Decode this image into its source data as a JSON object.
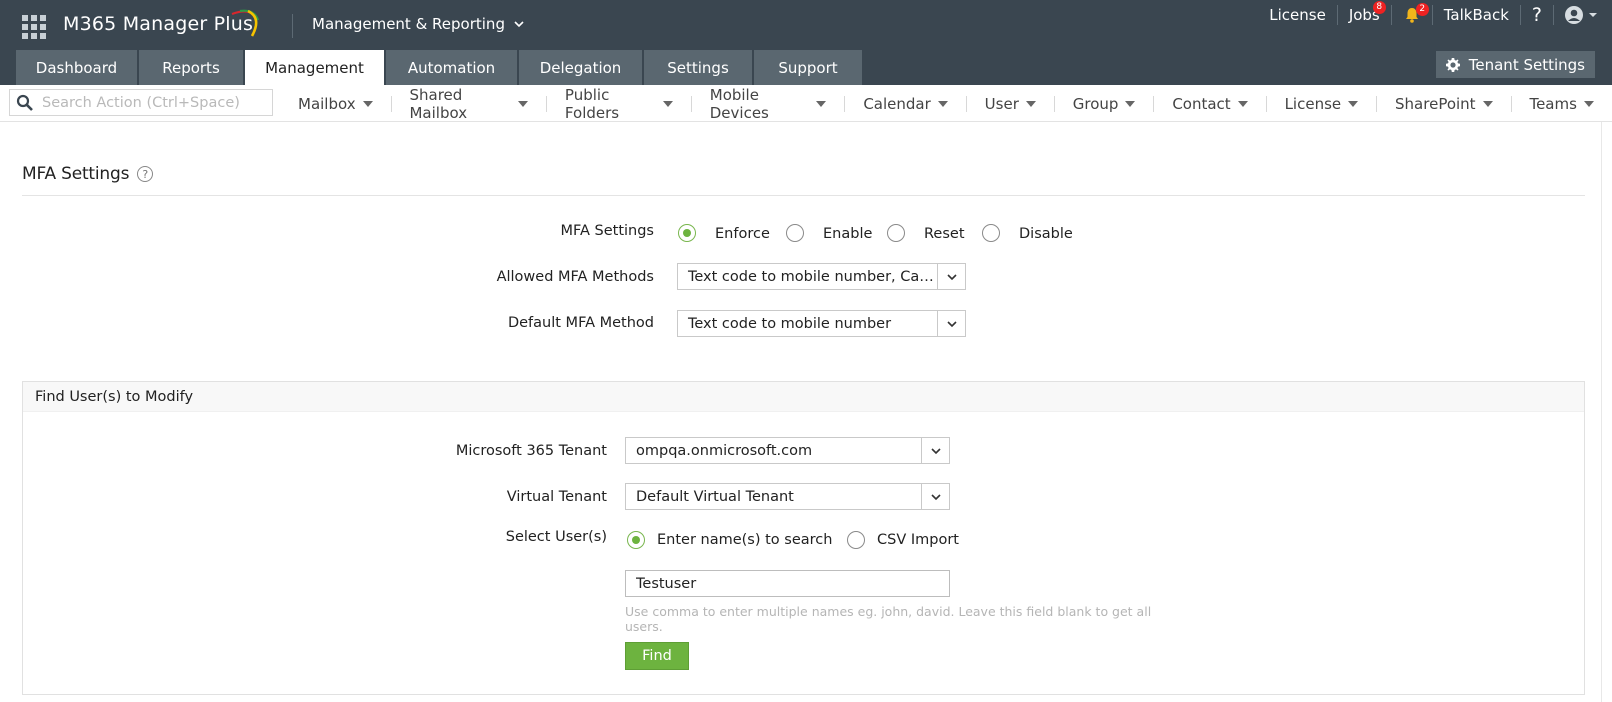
{
  "header": {
    "app_name": "M365 Manager Plus",
    "module": "Management & Reporting",
    "right": {
      "license": "License",
      "jobs": "Jobs",
      "jobs_badge": "8",
      "alerts_badge": "2",
      "talkback": "TalkBack",
      "help": "?"
    },
    "tabs": [
      {
        "label": "Dashboard",
        "active": false
      },
      {
        "label": "Reports",
        "active": false
      },
      {
        "label": "Management",
        "active": true
      },
      {
        "label": "Automation",
        "active": false
      },
      {
        "label": "Delegation",
        "active": false
      },
      {
        "label": "Settings",
        "active": false
      },
      {
        "label": "Support",
        "active": false
      }
    ],
    "tenant_settings": "Tenant Settings"
  },
  "subnav": {
    "search_placeholder": "Search Action (Ctrl+Space)",
    "menu": [
      "Mailbox",
      "Shared Mailbox",
      "Public Folders",
      "Mobile Devices",
      "Calendar",
      "User",
      "Group",
      "Contact",
      "License",
      "SharePoint",
      "Teams"
    ]
  },
  "page": {
    "title": "MFA Settings",
    "help_icon": "?"
  },
  "mfa": {
    "settings_label": "MFA Settings",
    "options": [
      {
        "label": "Enforce",
        "checked": true
      },
      {
        "label": "Enable",
        "checked": false
      },
      {
        "label": "Reset",
        "checked": false
      },
      {
        "label": "Disable",
        "checked": false
      }
    ],
    "allowed_label": "Allowed MFA Methods",
    "allowed_value": "Text code to mobile number, Call...",
    "default_label": "Default MFA Method",
    "default_value": "Text code to mobile number"
  },
  "find": {
    "panel_title": "Find User(s) to Modify",
    "tenant_label": "Microsoft 365 Tenant",
    "tenant_value": "ompqa.onmicrosoft.com",
    "virtual_label": "Virtual Tenant",
    "virtual_value": "Default Virtual Tenant",
    "select_label": "Select User(s)",
    "select_options": [
      {
        "label": "Enter name(s) to search",
        "checked": true
      },
      {
        "label": "CSV Import",
        "checked": false
      }
    ],
    "search_value": "Testuser",
    "hint": "Use comma to enter multiple names eg. john, david. Leave this field blank to get all users.",
    "find_button": "Find"
  },
  "colors": {
    "header_bg": "#3a4650",
    "tab_bg": "#5a6770",
    "accent_green": "#6db33f",
    "badge_red": "#ee2222"
  }
}
